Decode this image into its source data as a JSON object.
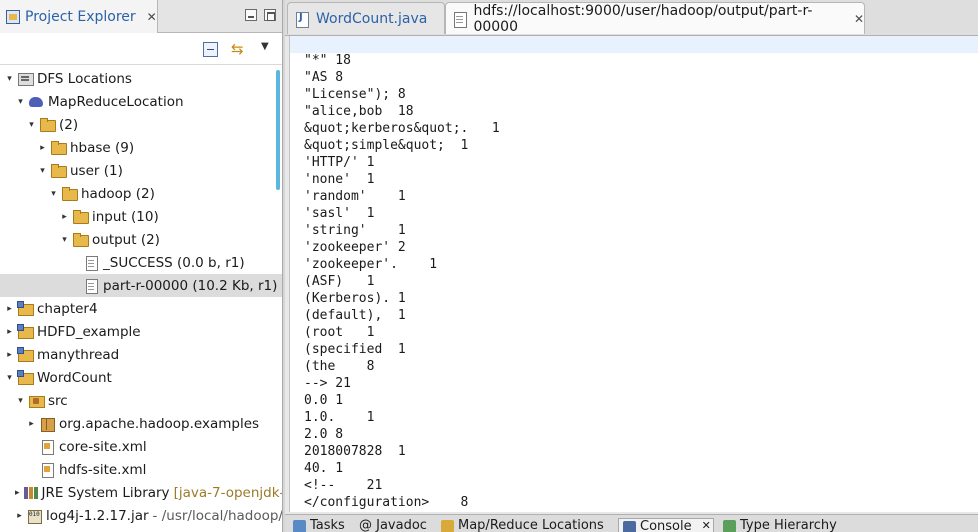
{
  "explorer": {
    "title": "Project Explorer",
    "tree": [
      {
        "indent": 0,
        "arrow": "▾",
        "icon": "dfs",
        "label": "DFS Locations",
        "decor": ""
      },
      {
        "indent": 1,
        "arrow": "▾",
        "icon": "elephant",
        "label": "MapReduceLocation",
        "decor": ""
      },
      {
        "indent": 2,
        "arrow": "▾",
        "icon": "folder",
        "label": "(2)",
        "decor": ""
      },
      {
        "indent": 3,
        "arrow": "▸",
        "icon": "folder",
        "label": "hbase (9)",
        "decor": ""
      },
      {
        "indent": 3,
        "arrow": "▾",
        "icon": "folder",
        "label": "user (1)",
        "decor": ""
      },
      {
        "indent": 4,
        "arrow": "▾",
        "icon": "folder",
        "label": "hadoop (2)",
        "decor": ""
      },
      {
        "indent": 5,
        "arrow": "▸",
        "icon": "folder",
        "label": "input (10)",
        "decor": ""
      },
      {
        "indent": 5,
        "arrow": "▾",
        "icon": "folder",
        "label": "output (2)",
        "decor": ""
      },
      {
        "indent": 6,
        "arrow": "",
        "icon": "file",
        "label": "_SUCCESS (0.0 b, r1)",
        "decor": ""
      },
      {
        "indent": 6,
        "arrow": "",
        "icon": "file",
        "label": "part-r-00000 (10.2 Kb, r1)",
        "decor": "",
        "selected": true
      },
      {
        "indent": 0,
        "arrow": "▸",
        "icon": "project",
        "label": "chapter4",
        "decor": ""
      },
      {
        "indent": 0,
        "arrow": "▸",
        "icon": "project",
        "label": "HDFD_example",
        "decor": ""
      },
      {
        "indent": 0,
        "arrow": "▸",
        "icon": "project",
        "label": "manythread",
        "decor": ""
      },
      {
        "indent": 0,
        "arrow": "▾",
        "icon": "project",
        "label": "WordCount",
        "decor": ""
      },
      {
        "indent": 1,
        "arrow": "▾",
        "icon": "srcfolder",
        "label": "src",
        "decor": ""
      },
      {
        "indent": 2,
        "arrow": "▸",
        "icon": "package",
        "label": "org.apache.hadoop.examples",
        "decor": ""
      },
      {
        "indent": 2,
        "arrow": "",
        "icon": "xml",
        "label": "core-site.xml",
        "decor": ""
      },
      {
        "indent": 2,
        "arrow": "",
        "icon": "xml",
        "label": "hdfs-site.xml",
        "decor": ""
      },
      {
        "indent": 1,
        "arrow": "▸",
        "icon": "library",
        "label": "JRE System Library",
        "decor": "[java-7-openjdk-"
      },
      {
        "indent": 1,
        "arrow": "▸",
        "icon": "jar",
        "label": "log4j-1.2.17.jar",
        "decor": "- /usr/local/hadoop/",
        "decor_gray": true
      }
    ]
  },
  "editor": {
    "tabs": [
      {
        "label": "WordCount.java",
        "closable": false
      },
      {
        "label": "hdfs://localhost:9000/user/hadoop/output/part-r-00000",
        "closable": true
      }
    ],
    "lines": [
      "\"*\" 18",
      "\"AS 8",
      "\"License\"); 8",
      "\"alice,bob  18",
      "&quot;kerberos&quot;.   1",
      "&quot;simple&quot;  1",
      "'HTTP/' 1",
      "'none'  1",
      "'random'    1",
      "'sasl'  1",
      "'string'    1",
      "'zookeeper' 2",
      "'zookeeper'.    1",
      "(ASF)   1",
      "(Kerberos). 1",
      "(default),  1",
      "(root   1",
      "(specified  1",
      "(the    8",
      "--> 21",
      "0.0 1",
      "1.0.    1",
      "2.0 8",
      "2018007828  1",
      "40. 1",
      "<!--    21",
      "</configuration>    8"
    ]
  },
  "bottom_tabs": [
    {
      "label": "Tasks",
      "color": "#5a8ac6"
    },
    {
      "label": "@ Javadoc",
      "color": ""
    },
    {
      "label": "Map/Reduce Locations",
      "color": "#d9a93a"
    },
    {
      "label": "Console",
      "color": "#4a6aa0",
      "active": true
    },
    {
      "label": "Type Hierarchy",
      "color": "#5aa05a"
    }
  ],
  "colors": {
    "accent": "#2b62a8",
    "selection": "#dcdcdc",
    "current_line": "#e8f2fe"
  }
}
